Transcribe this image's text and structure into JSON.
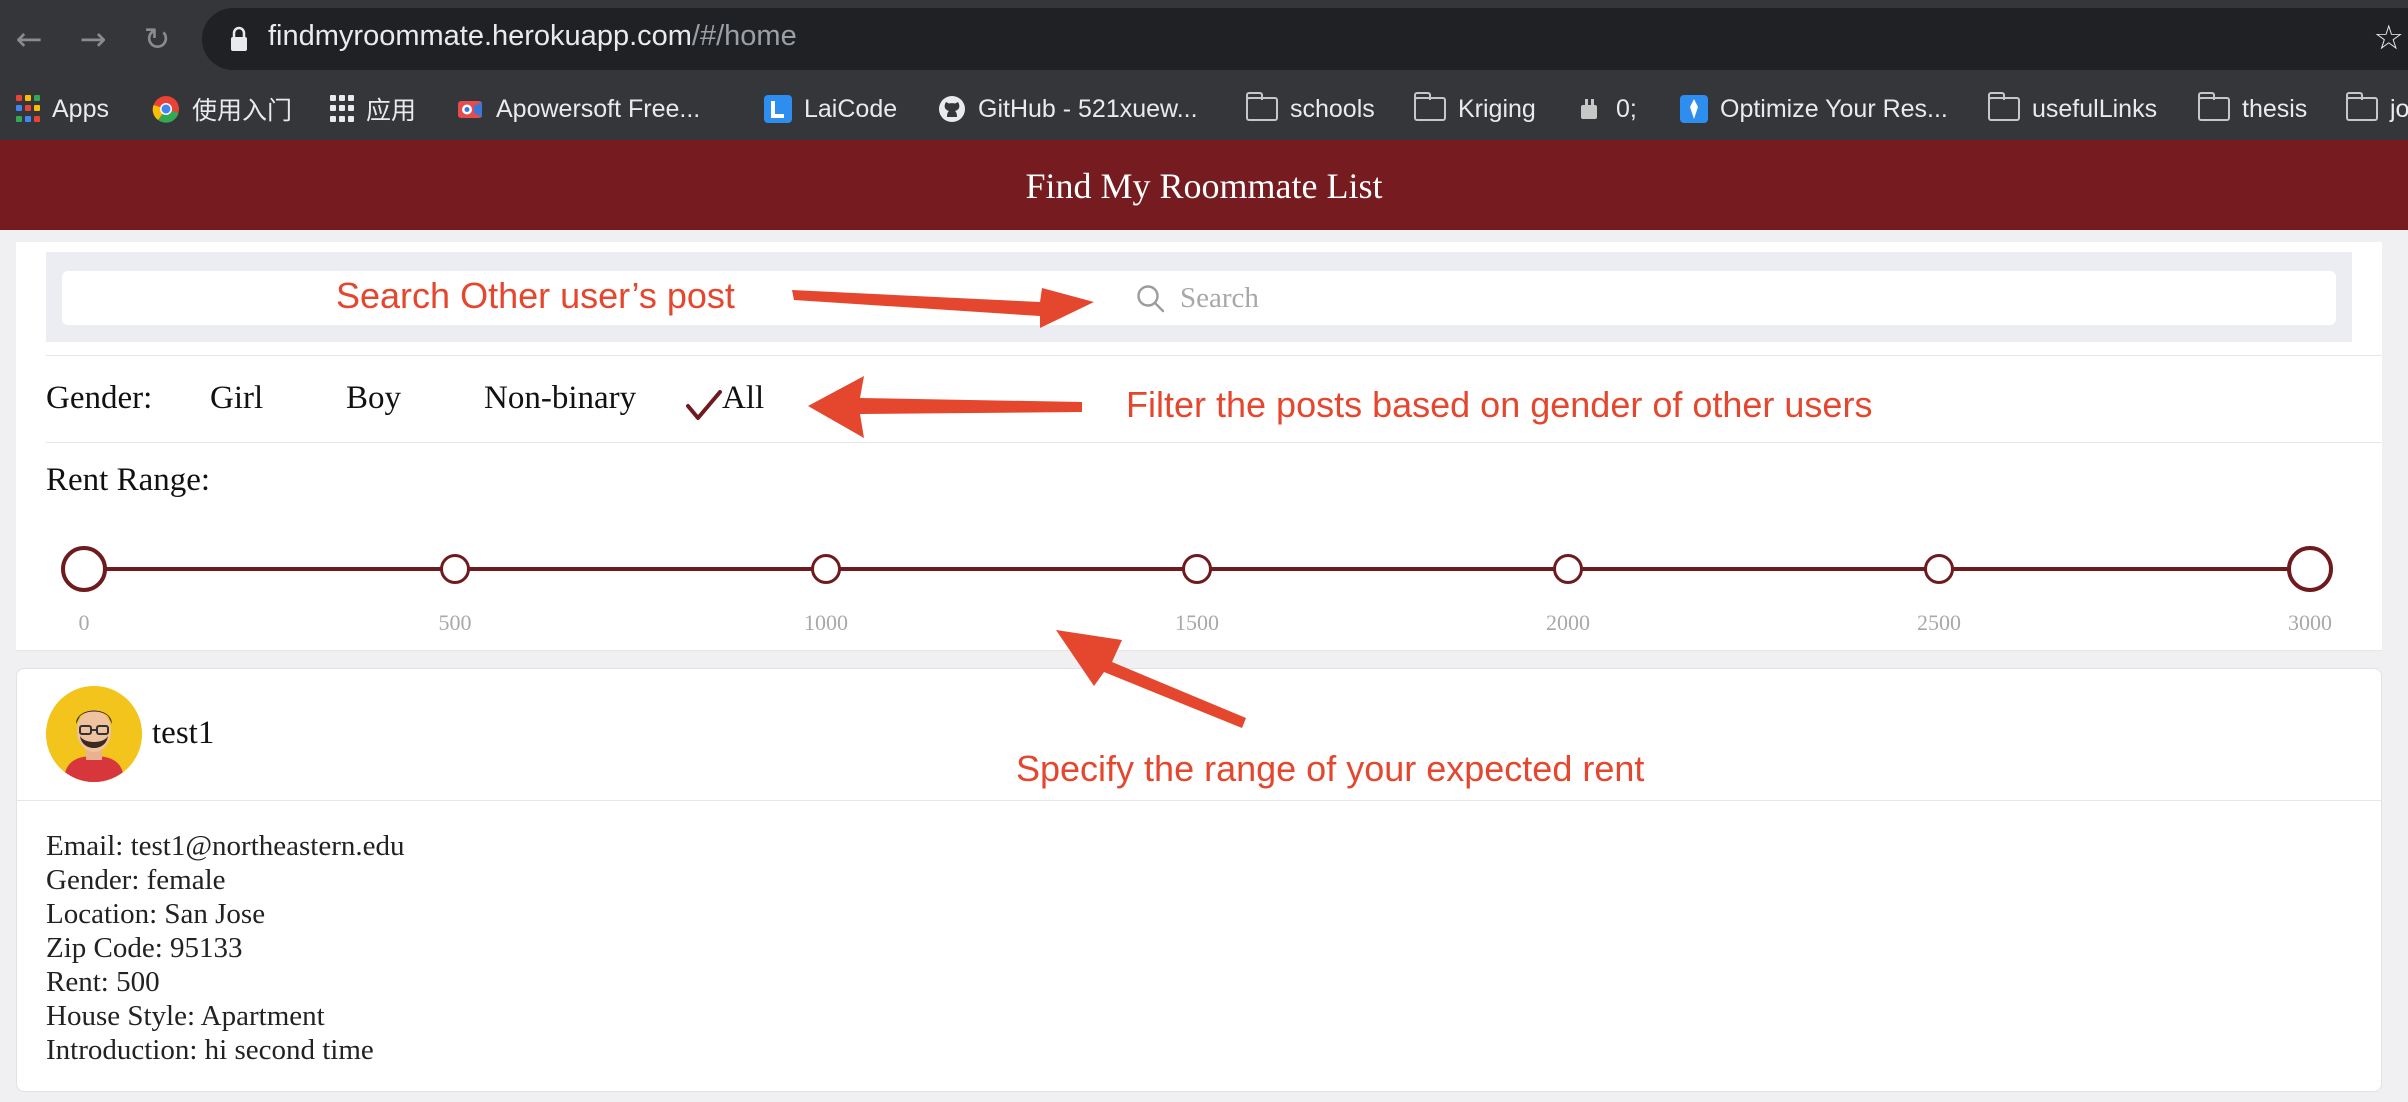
{
  "browser": {
    "url_host": "findmyroommate.herokuapp.com",
    "url_path": "/#/home",
    "bookmarks": [
      {
        "label": "Apps",
        "icon": "apps-grid-icon"
      },
      {
        "label": "使用入门",
        "icon": "chrome-icon"
      },
      {
        "label": "应用",
        "icon": "apps-grid-icon"
      },
      {
        "label": "Apowersoft Free...",
        "icon": "apowersoft-icon"
      },
      {
        "label": "LaiCode",
        "icon": "laicode-icon"
      },
      {
        "label": "GitHub - 521xuew...",
        "icon": "github-icon"
      },
      {
        "label": "schools",
        "icon": "folder-icon"
      },
      {
        "label": "Kriging",
        "icon": "folder-icon"
      },
      {
        "label": "0;",
        "icon": "extension-icon"
      },
      {
        "label": "Optimize Your Res...",
        "icon": "optimize-icon"
      },
      {
        "label": "usefulLinks",
        "icon": "folder-icon"
      },
      {
        "label": "thesis",
        "icon": "folder-icon"
      },
      {
        "label": "jo",
        "icon": "folder-icon"
      }
    ]
  },
  "header": {
    "title": "Find My Roommate List"
  },
  "search": {
    "placeholder": "Search"
  },
  "filters": {
    "gender_label": "Gender:",
    "gender_options": [
      "Girl",
      "Boy",
      "Non-binary",
      "All"
    ],
    "selected_gender": "All",
    "rent_label": "Rent Range:",
    "rent_ticks": [
      "0",
      "500",
      "1000",
      "1500",
      "2000",
      "2500",
      "3000"
    ],
    "rent_min": 0,
    "rent_max": 3000,
    "selected_range": [
      0,
      3000
    ]
  },
  "post": {
    "username": "test1",
    "details": [
      "Email: test1@northeastern.edu",
      "Gender: female",
      "Location: San Jose",
      "Zip Code: 95133",
      "Rent: 500",
      "House Style: Apartment",
      "Introduction: hi second time"
    ]
  },
  "annotations": {
    "search_note": "Search Other user’s post",
    "filter_note": "Filter the posts based on gender of other users",
    "range_note": "Specify the range of your expected rent"
  },
  "colors": {
    "brand": "#761b1f",
    "annotation": "#e4472e"
  }
}
